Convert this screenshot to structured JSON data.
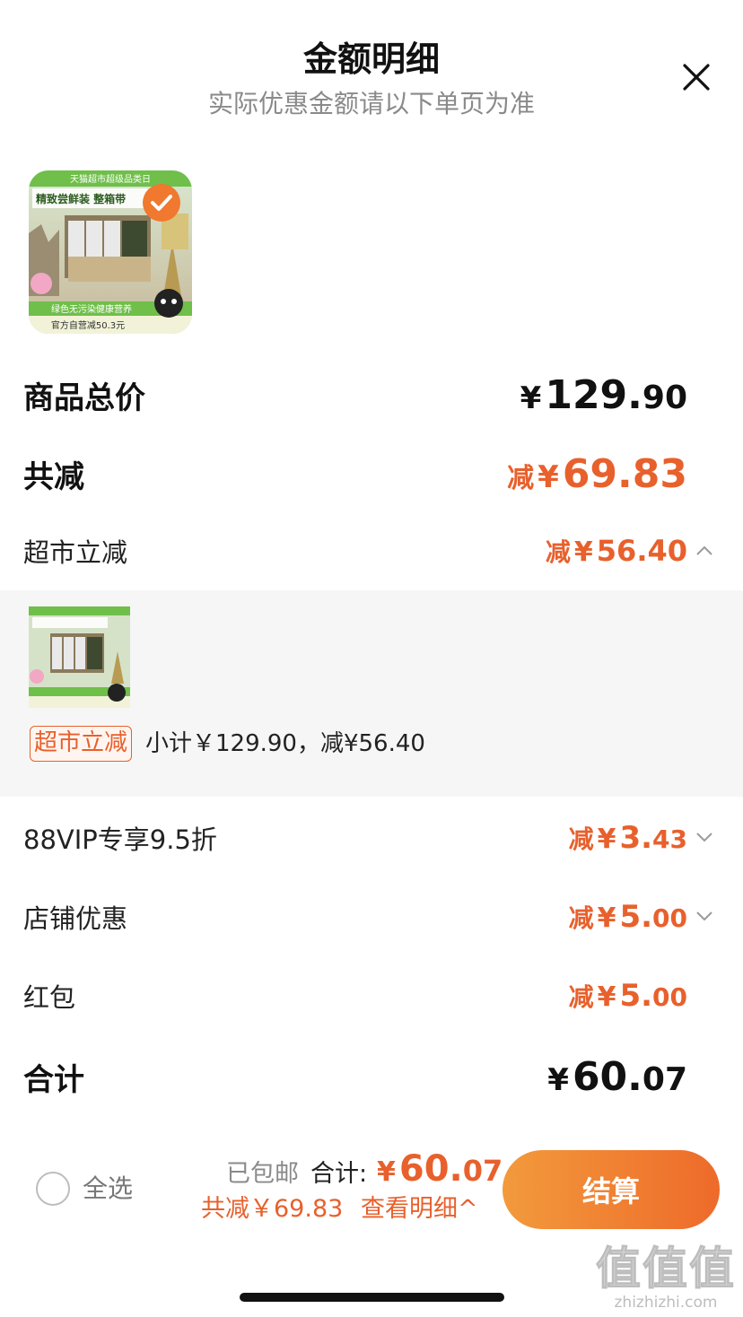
{
  "header": {
    "title": "金额明细",
    "subtitle": "实际优惠金额请以下单页为准"
  },
  "product_image": {
    "banner_top": "天猫超市超级品类日",
    "headline": "精致尝鲜装 整箱带",
    "slogan": "绿色无污染健康营养",
    "promo": "官方自营减50.3元"
  },
  "rows": {
    "goods_total": {
      "label": "商品总价",
      "currency": "¥",
      "int": "129.",
      "dec": "90"
    },
    "total_reduction": {
      "label": "共减",
      "prefix": "减",
      "currency": "¥",
      "int": "69.83",
      "dec": ""
    },
    "supermarket": {
      "label": "超市立减",
      "prefix": "减",
      "currency": "¥",
      "int": "56.40",
      "dec": ""
    },
    "vip": {
      "label": "88VIP专享9.5折",
      "prefix": "减",
      "currency": "¥",
      "int": "3.",
      "dec": "43"
    },
    "store": {
      "label": "店铺优惠",
      "prefix": "减",
      "currency": "¥",
      "int": "5.",
      "dec": "00"
    },
    "redpacket": {
      "label": "红包",
      "prefix": "减",
      "currency": "¥",
      "int": "5.",
      "dec": "00"
    },
    "sum": {
      "label": "合计",
      "currency": "¥",
      "int": "60.",
      "dec": "07"
    }
  },
  "expand": {
    "tag": "超市立减",
    "subtotal": "小计￥129.90，减¥56.40"
  },
  "bottom_bar": {
    "select_all": "全选",
    "shipping": "已包邮",
    "total_label": "合计:",
    "total_currency": "¥",
    "total_int": "60.",
    "total_dec": "07",
    "reduced": "共减￥69.83",
    "view_detail": "查看明细^",
    "checkout": "结算"
  },
  "watermark": {
    "logo": "值值值",
    "url": "zhizhizhi.com"
  },
  "colors": {
    "accent": "#e8602c",
    "checkout_start": "#f29a3c",
    "checkout_end": "#ee6a2a",
    "expand_bg": "#f6f6f6"
  }
}
